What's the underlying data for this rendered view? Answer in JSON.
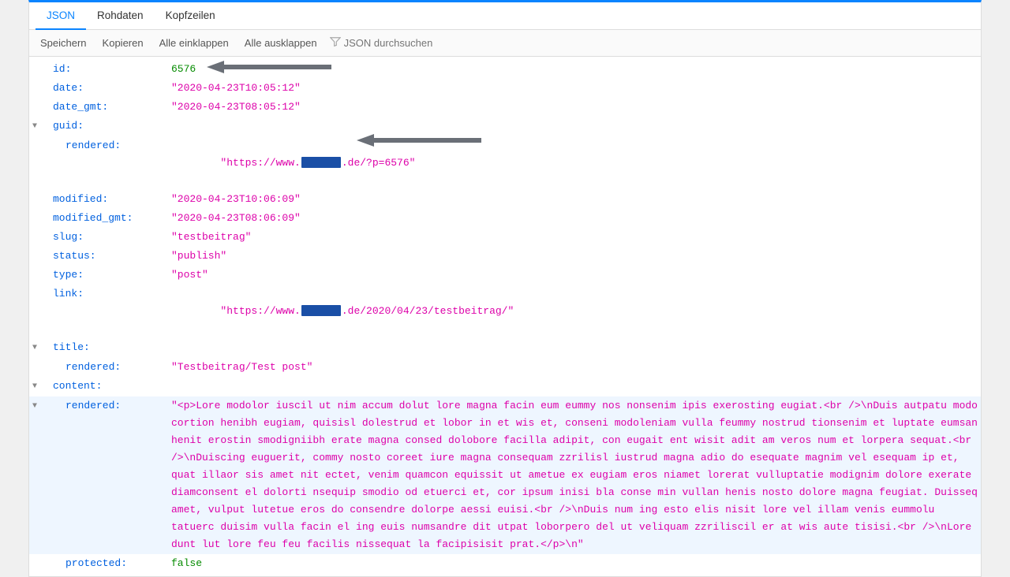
{
  "tabs": {
    "json": "JSON",
    "raw": "Rohdaten",
    "headers": "Kopfzeilen"
  },
  "toolbar": {
    "save": "Speichern",
    "copy": "Kopieren",
    "collapse_all": "Alle einklappen",
    "expand_all": "Alle ausklappen",
    "search_placeholder": "JSON durchsuchen"
  },
  "keys": {
    "id": "id:",
    "date": "date:",
    "date_gmt": "date_gmt:",
    "guid": "guid:",
    "rendered": "rendered:",
    "modified": "modified:",
    "modified_gmt": "modified_gmt:",
    "slug": "slug:",
    "status": "status:",
    "type": "type:",
    "link": "link:",
    "title": "title:",
    "content": "content:",
    "protected": "protected:"
  },
  "values": {
    "id": "6576",
    "date": "\"2020-04-23T10:05:12\"",
    "date_gmt": "\"2020-04-23T08:05:12\"",
    "guid_rendered_prefix": "\"https://www.",
    "guid_rendered_suffix": ".de/?p=6576\"",
    "modified": "\"2020-04-23T10:06:09\"",
    "modified_gmt": "\"2020-04-23T08:06:09\"",
    "slug": "\"testbeitrag\"",
    "status": "\"publish\"",
    "type": "\"post\"",
    "link_prefix": "\"https://www.",
    "link_suffix": ".de/2020/04/23/testbeitrag/\"",
    "title_rendered": "\"Testbeitrag/Test post\"",
    "content_rendered": "\"<p>Lore modolor iuscil ut nim accum dolut lore magna facin eum eummy nos nonsenim ipis exerosting eugiat.<br />\\nDuis autpatu modo cortion henibh eugiam, quisisl dolestrud et lobor in et wis et, conseni modoleniam vulla feummy nostrud tionsenim et luptate eumsan henit erostin smodigniibh erate magna consed dolobore facilla adipit, con eugait ent wisit adit am veros num et lorpera sequat.<br />\\nDuiscing euguerit, commy nosto coreet iure magna consequam zzrilisl iustrud magna adio do esequate magnim vel esequam ip et, quat illaor sis amet nit ectet, venim quamcon equissit ut ametue ex eugiam eros niamet lorerat vulluptatie modignim dolore exerate diamconsent el dolorti nsequip smodio od etuerci et, cor ipsum inisi bla conse min vullan henis nosto dolore magna feugiat. Duisseq amet, vulput lutetue eros do consendre dolorpe aessi euisi.<br />\\nDuis num ing esto elis nisit lore vel illam venis eummolu tatuerc duisim vulla facin el ing euis numsandre dit utpat loborpero del ut veliquam zzriliscil er at wis aute tisisi.<br />\\nLore dunt lut lore feu feu facilis nissequat la facipisisit prat.</p>\\n\"",
    "protected": "false"
  }
}
